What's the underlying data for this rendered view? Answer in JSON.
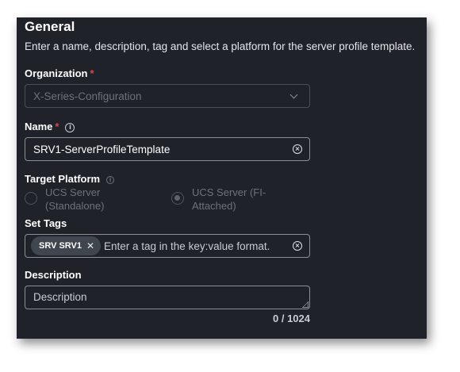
{
  "general": {
    "title": "General",
    "subtitle": "Enter a name, description, tag and select a platform for the server profile template."
  },
  "organization": {
    "label": "Organization",
    "required_mark": "*",
    "value": "X-Series-Configuration"
  },
  "name": {
    "label": "Name",
    "required_mark": "*",
    "value": "SRV1-ServerProfileTemplate"
  },
  "target_platform": {
    "label": "Target Platform",
    "options": [
      {
        "label": "UCS Server (Standalone)",
        "selected": false
      },
      {
        "label": "UCS Server (FI-Attached)",
        "selected": true
      }
    ]
  },
  "tags": {
    "label": "Set Tags",
    "chips": [
      {
        "label": "SRV SRV1"
      }
    ],
    "placeholder": "Enter a tag in the key:value format."
  },
  "description": {
    "label": "Description",
    "placeholder": "Description",
    "counter": "0 / 1024"
  },
  "icons": {
    "info": "info-icon",
    "clear": "clear-icon",
    "chevron": "chevron-down-icon",
    "remove_tag": "close-icon"
  },
  "colors": {
    "panel_bg": "#1f2329",
    "required": "#e0454d",
    "chip_bg": "#40464d"
  }
}
